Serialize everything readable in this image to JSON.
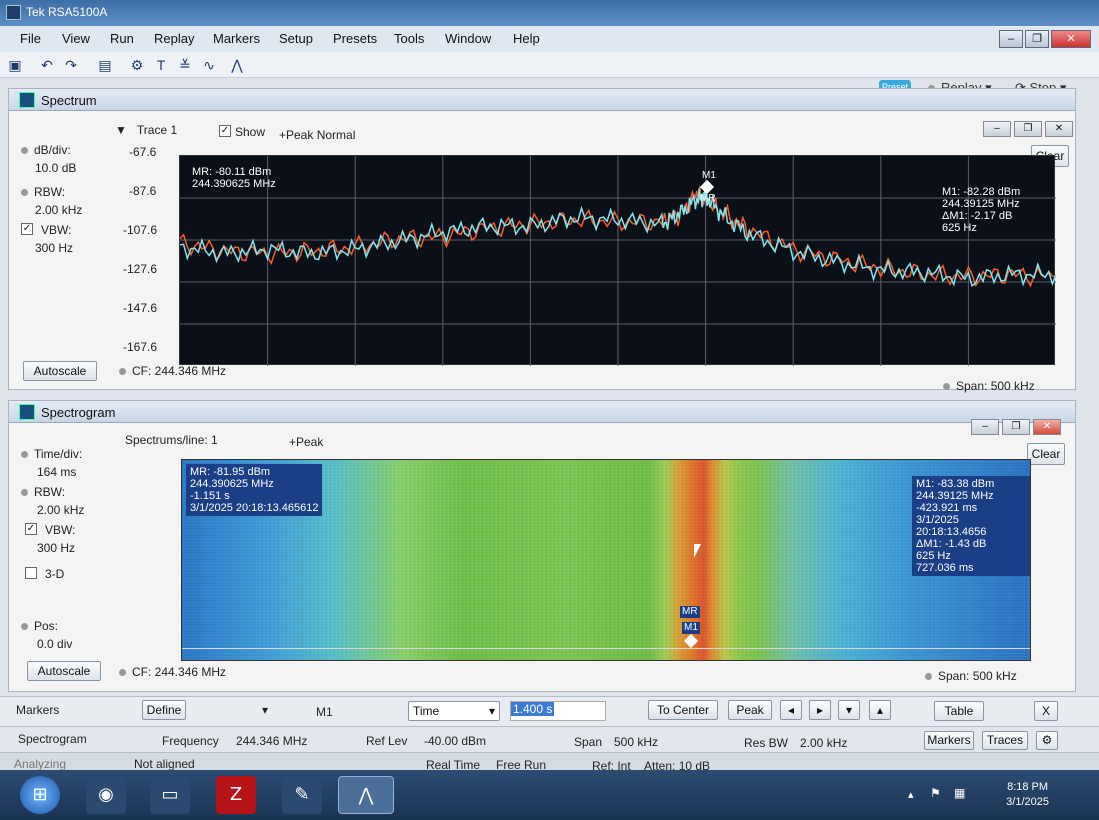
{
  "app": {
    "title": "Tek RSA5100A"
  },
  "menu": [
    "File",
    "View",
    "Run",
    "Replay",
    "Markers",
    "Setup",
    "Presets",
    "Tools",
    "Window",
    "Help"
  ],
  "run": {
    "preset": "Preset",
    "replay": "Replay",
    "stop": "Stop"
  },
  "spectrum": {
    "title": "Spectrum",
    "trace": "Trace 1",
    "show": "Show",
    "detector": "+Peak Normal",
    "dbdiv_label": "dB/div:",
    "dbdiv": "10.0 dB",
    "rbw_label": "RBW:",
    "rbw": "2.00 kHz",
    "vbw_label": "VBW:",
    "vbw": "300 Hz",
    "autoscale": "Autoscale",
    "cf": "CF: 244.346 MHz",
    "span": "Span:  500 kHz",
    "clear": "Clear",
    "mr_readout": [
      "MR: -80.11 dBm",
      "244.390625 MHz"
    ],
    "m1_readout": [
      "M1: -82.28 dBm",
      "244.39125 MHz",
      "ΔM1: -2.17 dB",
      "625 Hz"
    ],
    "m1": "M1",
    "mr": "MR"
  },
  "chart_data": {
    "type": "line",
    "ylabel": "",
    "yticks": [
      "-67.6",
      "-87.6",
      "-107.6",
      "-127.6",
      "-147.6",
      "-167.6"
    ],
    "ylim": [
      -167.6,
      -67.6
    ],
    "xlim_mhz": [
      244.096,
      244.596
    ],
    "series": [
      {
        "color": "#ff5a2a",
        "x": [
          0,
          0.05,
          0.1,
          0.15,
          0.2,
          0.25,
          0.3,
          0.35,
          0.4,
          0.45,
          0.5,
          0.55,
          0.57,
          0.59,
          0.6,
          0.62,
          0.65,
          0.7,
          0.75,
          0.8,
          0.85,
          0.9,
          0.95,
          1
        ],
        "values": [
          -109,
          -113,
          -114,
          -113,
          -111,
          -107,
          -106,
          -102,
          -100,
          -98,
          -99,
          -99,
          -96,
          -86,
          -88,
          -95,
          -103,
          -112,
          -117,
          -121,
          -124,
          -125,
          -124,
          -125
        ]
      },
      {
        "color": "#7fe7f0",
        "x": [
          0,
          0.05,
          0.1,
          0.15,
          0.2,
          0.25,
          0.3,
          0.35,
          0.4,
          0.45,
          0.5,
          0.55,
          0.57,
          0.59,
          0.6,
          0.62,
          0.65,
          0.7,
          0.75,
          0.8,
          0.85,
          0.9,
          0.95,
          1
        ],
        "values": [
          -111,
          -114,
          -112,
          -114,
          -112,
          -108,
          -104,
          -101,
          -101,
          -97,
          -98,
          -100,
          -95,
          -88,
          -87,
          -96,
          -105,
          -113,
          -118,
          -122,
          -123,
          -126,
          -124,
          -124
        ]
      }
    ]
  },
  "spectrogram": {
    "title": "Spectrogram",
    "lines": "Spectrums/line: 1",
    "detector": "+Peak",
    "timediv_label": "Time/div:",
    "timediv": "164 ms",
    "rbw_label": "RBW:",
    "rbw": "2.00 kHz",
    "vbw_label": "VBW:",
    "vbw": "300 Hz",
    "threed": "3-D",
    "pos_label": "Pos:",
    "pos": "0.0 div",
    "autoscale": "Autoscale",
    "cf": "CF: 244.346 MHz",
    "span": "Span:  500 kHz",
    "clear": "Clear",
    "mr_readout": [
      "MR: -81.95 dBm",
      "244.390625 MHz",
      "-1.151 s",
      "3/1/2025 20:18:13.465612"
    ],
    "m1_readout": [
      "M1: -83.38 dBm",
      "244.39125 MHz",
      "-423.921 ms",
      "3/1/2025 20:18:13.4656",
      "ΔM1: -1.43 dB",
      "625 Hz",
      "727.036 ms"
    ],
    "mr": "MR",
    "m1": "M1"
  },
  "markers_bar": {
    "label": "Markers",
    "define": "Define",
    "marker": "M1",
    "mode": "Time",
    "value": "1.400 s",
    "to_center": "To Center",
    "peak": "Peak",
    "table": "Table",
    "close": "X"
  },
  "status": {
    "view": "Spectrogram",
    "freq_label": "Frequency",
    "freq": "244.346 MHz",
    "ref_label": "Ref Lev",
    "ref": "-40.00 dBm",
    "span_label": "Span",
    "span": "500 kHz",
    "resbw_label": "Res BW",
    "resbw": "2.00 kHz",
    "markers": "Markers",
    "traces": "Traces"
  },
  "footer": {
    "state": "Analyzing",
    "align": "Not aligned",
    "realtime": "Real Time",
    "mode": "Free Run",
    "ref": "Ref: Int",
    "atten": "Atten: 10 dB"
  },
  "clock": {
    "time": "8:18 PM",
    "date": "3/1/2025"
  }
}
